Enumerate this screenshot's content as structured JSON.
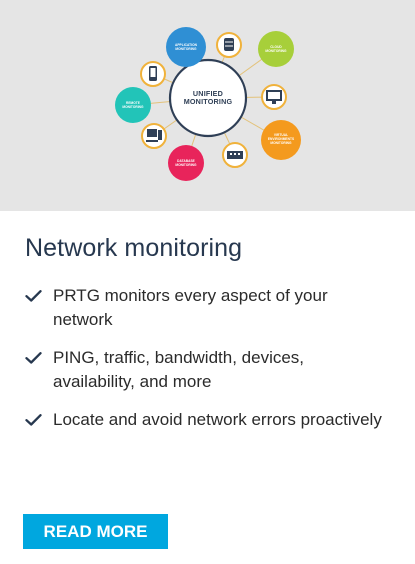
{
  "graphic": {
    "center_lines": [
      "UNIFIED",
      "MONITORING"
    ],
    "bubbles": [
      {
        "name": "application-monitoring-node",
        "lines": [
          "APPLICATION",
          "MONITORING"
        ],
        "color": "#2f8fd4"
      },
      {
        "name": "cloud-monitoring-node",
        "lines": [
          "CLOUD",
          "MONITORING"
        ],
        "color": "#a7cf3a"
      },
      {
        "name": "virtual-environments-node",
        "lines": [
          "VIRTUAL",
          "ENVIRONMENTS",
          "MONITORING"
        ],
        "color": "#f49a1e"
      },
      {
        "name": "database-monitoring-node",
        "lines": [
          "DATABASE",
          "MONITORING"
        ],
        "color": "#e8245b"
      },
      {
        "name": "remote-monitoring-node",
        "lines": [
          "REMOTE",
          "MONITORING"
        ],
        "color": "#22c4b8"
      }
    ],
    "icons": [
      "database-server-icon",
      "mobile-device-icon",
      "desktop-monitor-icon",
      "workstation-icon",
      "network-switch-icon"
    ]
  },
  "card": {
    "title": "Network monitoring",
    "features": [
      "PRTG monitors every aspect of your network",
      "PING, traffic, bandwidth, devices, availability, and more",
      "Locate and avoid network errors proactively"
    ],
    "button_label": "READ MORE"
  },
  "colors": {
    "hero_background": "#e5e5e5",
    "button": "#00a7df",
    "title": "#27384f",
    "check": "#27384f"
  }
}
